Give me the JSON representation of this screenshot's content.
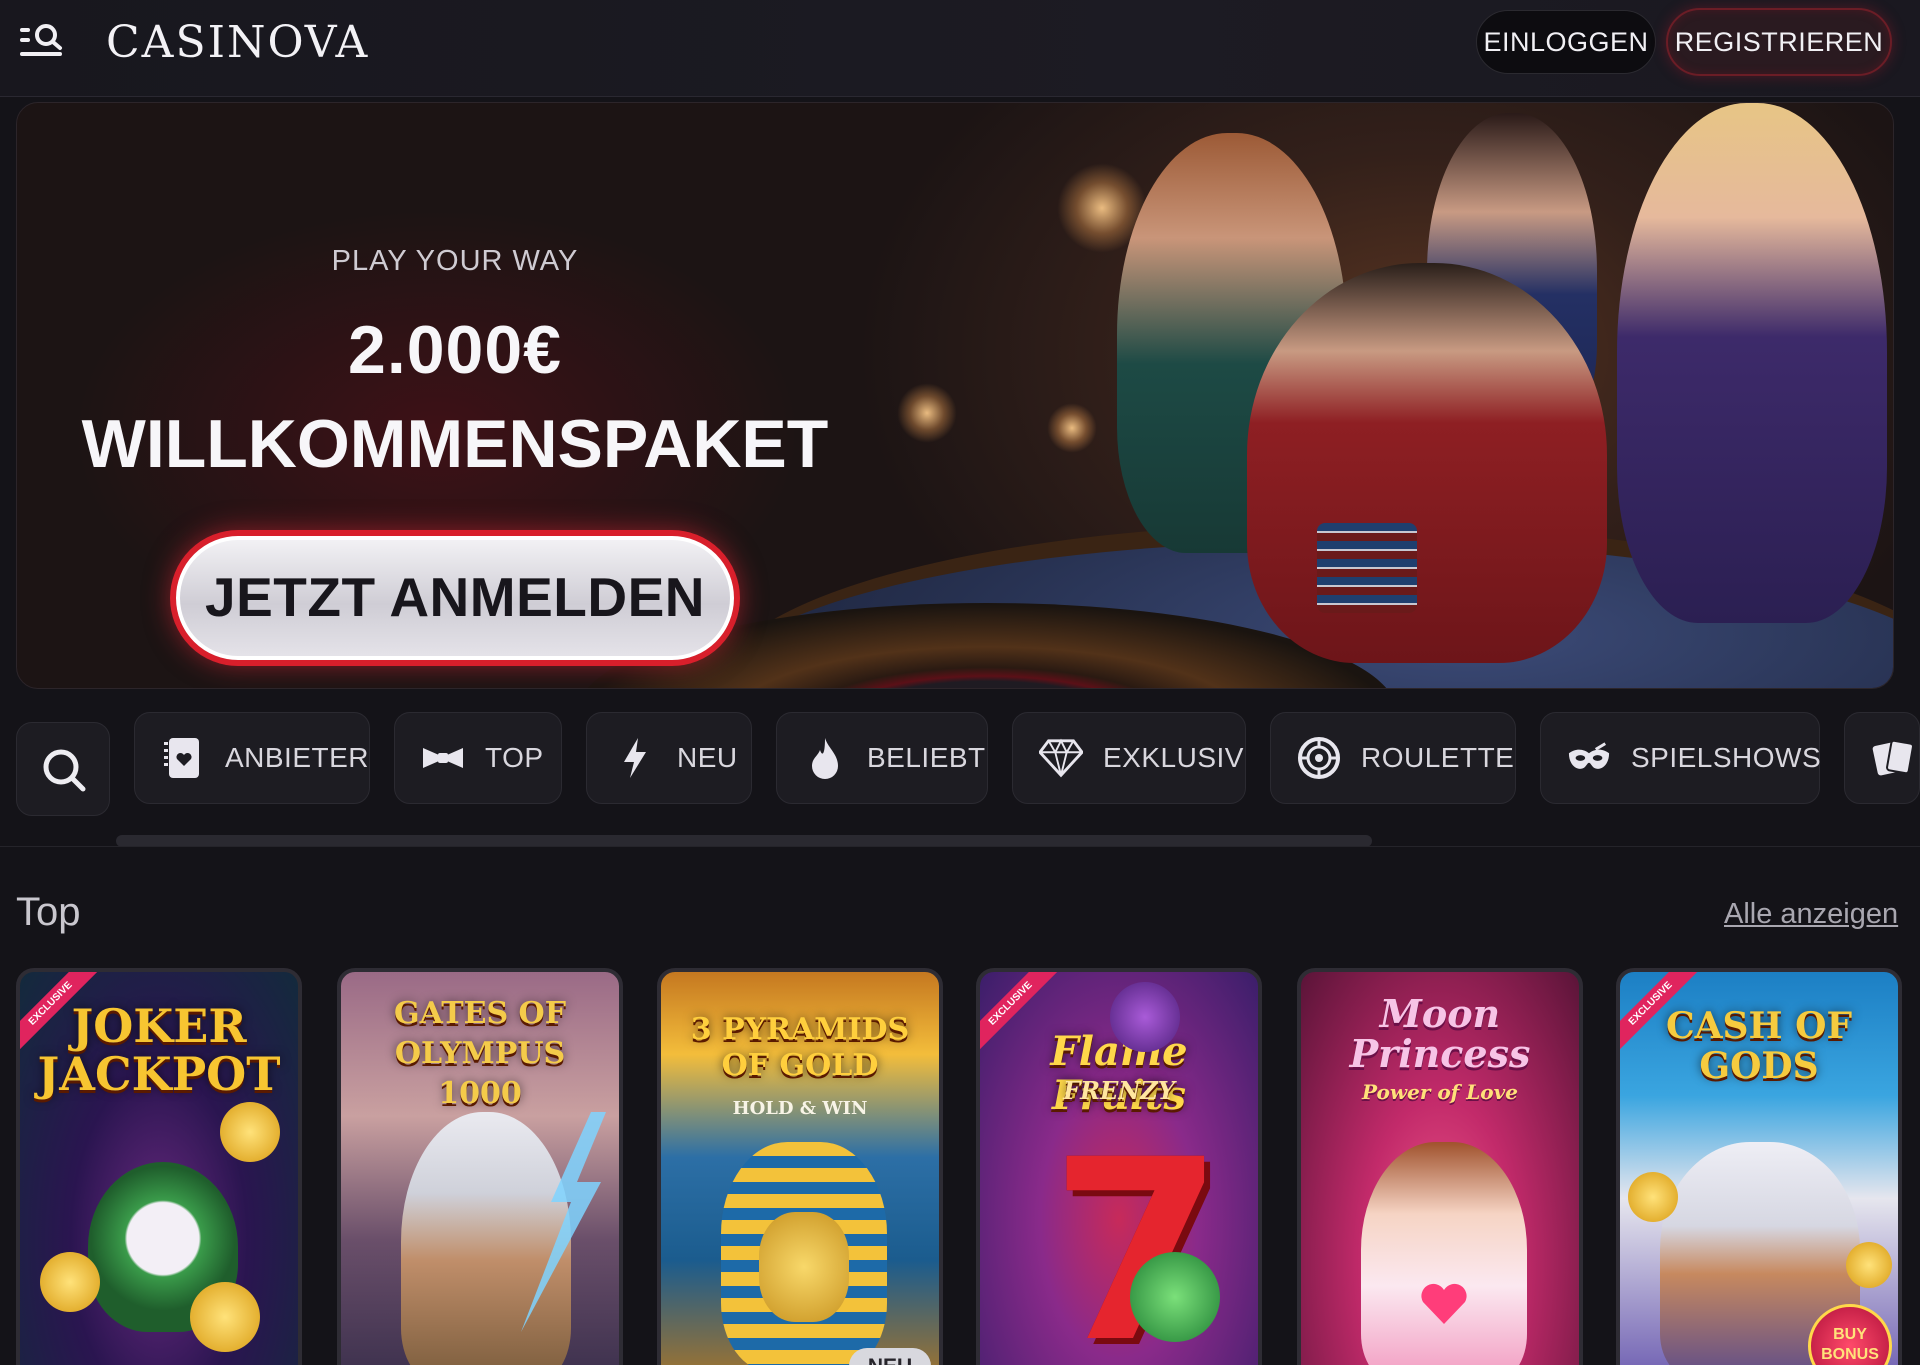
{
  "header": {
    "logo": "CASINOVA",
    "login_label": "EINLOGGEN",
    "register_label": "REGISTRIEREN"
  },
  "hero": {
    "eyebrow": "PLAY YOUR WAY",
    "amount": "2.000€",
    "headline": "WILLKOMMENSPAKET",
    "cta_label": "JETZT ANMELDEN"
  },
  "categories": [
    {
      "label": "ANBIETER",
      "icon": "provider-card-icon"
    },
    {
      "label": "TOP",
      "icon": "bowtie-icon"
    },
    {
      "label": "NEU",
      "icon": "lightning-icon"
    },
    {
      "label": "BELIEBT",
      "icon": "flame-icon"
    },
    {
      "label": "EXKLUSIV",
      "icon": "diamond-icon"
    },
    {
      "label": "ROULETTE",
      "icon": "roulette-icon"
    },
    {
      "label": "SPIELSHOWS",
      "icon": "mask-icon"
    }
  ],
  "section": {
    "title": "Top",
    "see_all": "Alle anzeigen"
  },
  "games": [
    {
      "title": "JOKER JACKPOT",
      "ribbon": "EXCLUSIVE",
      "badge": ""
    },
    {
      "title": "GATES OF OLYMPUS 1000",
      "ribbon": "",
      "badge": ""
    },
    {
      "title": "3 PYRAMIDS OF GOLD",
      "subtitle": "HOLD & WIN",
      "ribbon": "",
      "badge": "NEU"
    },
    {
      "title": "Flame Fruits",
      "subtitle": "FRENZY",
      "ribbon": "EXCLUSIVE",
      "badge": ""
    },
    {
      "title": "Moon Princess",
      "subtitle": "Power of Love",
      "ribbon": "",
      "badge": ""
    },
    {
      "title": "CASH OF GODS",
      "ribbon": "EXCLUSIVE",
      "badge": "BUY BONUS"
    }
  ],
  "colors": {
    "background": "#141318",
    "accent_red": "#d81f2b",
    "surface": "#1d1c22"
  }
}
